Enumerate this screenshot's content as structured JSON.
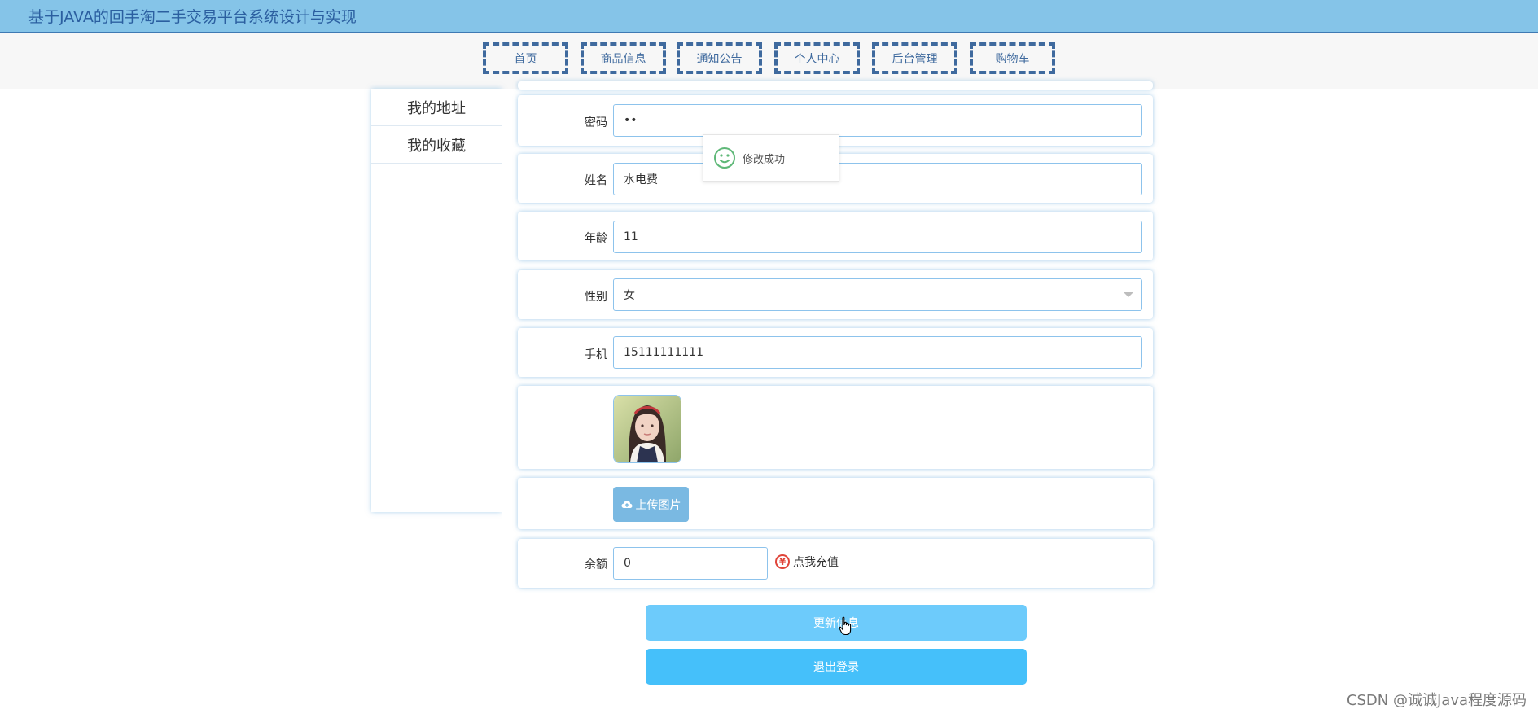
{
  "header": {
    "title": "基于JAVA的回手淘二手交易平台系统设计与实现"
  },
  "nav": {
    "items": [
      {
        "label": "首页"
      },
      {
        "label": "商品信息"
      },
      {
        "label": "通知公告"
      },
      {
        "label": "个人中心"
      },
      {
        "label": "后台管理"
      },
      {
        "label": "购物车"
      }
    ]
  },
  "sidebar": {
    "items": [
      {
        "label": "我的地址"
      },
      {
        "label": "我的收藏"
      }
    ]
  },
  "form": {
    "password": {
      "label": "密码",
      "value": "••"
    },
    "name": {
      "label": "姓名",
      "value": "水电费"
    },
    "age": {
      "label": "年龄",
      "value": "11"
    },
    "gender": {
      "label": "性别",
      "value": "女"
    },
    "phone": {
      "label": "手机",
      "value": "15111111111"
    },
    "upload_label": "上传图片",
    "balance": {
      "label": "余额",
      "value": "0"
    },
    "recharge_label": "点我充值",
    "recharge_icon_glyph": "¥"
  },
  "buttons": {
    "update": "更新信息",
    "logout": "退出登录"
  },
  "toast": {
    "message": "修改成功",
    "icon": "smile-icon"
  },
  "watermark": "CSDN @诚诚Java程度源码",
  "colors": {
    "topbar": "#85c4e8",
    "nav_border": "#3f6a9e",
    "update_button": "#6dcbfb",
    "logout_button": "#45c0fa",
    "upload_button": "#7ab9e2"
  }
}
